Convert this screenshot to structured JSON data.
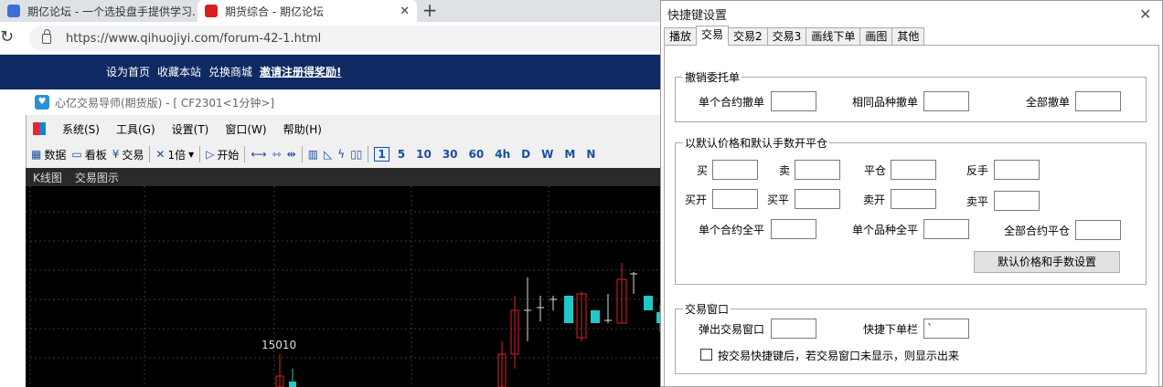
{
  "browser": {
    "tabs": [
      {
        "title": "期亿论坛 - 一个选投盘手提供学习…",
        "favicon_color": "#3b6fd8"
      },
      {
        "title": "期货综合 - 期亿论坛",
        "favicon_color": "#d81e1e"
      }
    ],
    "url": "https://www.qihuojiyi.com/forum-42-1.html"
  },
  "site": {
    "links": [
      "设为首页",
      "收藏本站",
      "兑换商城",
      "邀请注册得奖励!"
    ],
    "bar_color": "#0f2a63"
  },
  "app": {
    "title": "心亿交易导师(期货版) - [ CF2301<1分钟>]",
    "menu": [
      "系统(S)",
      "工具(G)",
      "设置(T)",
      "窗口(W)",
      "帮助(H)"
    ],
    "toolbar": {
      "data": "数据",
      "board": "看板",
      "trade": "交易",
      "zoom": "1倍",
      "start": "开始",
      "periods": [
        "1",
        "5",
        "10",
        "30",
        "60",
        "4h",
        "D",
        "W",
        "M",
        "N"
      ],
      "selected_period": "1"
    },
    "panel_tabs": [
      "K线图",
      "交易图示"
    ],
    "price_label": "15010",
    "chart_data": {
      "type": "candlestick",
      "up_color": "#e02020",
      "down_color": "#20c8c8"
    }
  },
  "dialog": {
    "title": "快捷键设置",
    "tabs": [
      "播放",
      "交易",
      "交易2",
      "交易3",
      "画线下单",
      "画图",
      "其他"
    ],
    "active_tab": "交易",
    "group_cancel": {
      "legend": "撤销委托单",
      "single": "单个合约撤单",
      "same": "相同品种撤单",
      "all": "全部撤单",
      "values": [
        "",
        "",
        ""
      ]
    },
    "group_close": {
      "legend": "以默认价格和默认手数开平仓",
      "buy": "买",
      "sell": "卖",
      "flat": "平仓",
      "reverse": "反手",
      "buy_open": "买开",
      "buy_close": "买平",
      "sell_open": "卖开",
      "sell_close": "卖平",
      "single_flat": "单个合约全平",
      "variety_flat": "单个品种全平",
      "all_flat": "全部合约平仓",
      "button": "默认价格和手数设置"
    },
    "group_window": {
      "legend": "交易窗口",
      "popup": "弹出交易窗口",
      "quick_bar": "快捷下单栏",
      "quick_bar_value": "`",
      "checkbox_label": "按交易快捷键后，若交易窗口未显示，则显示出来"
    }
  }
}
